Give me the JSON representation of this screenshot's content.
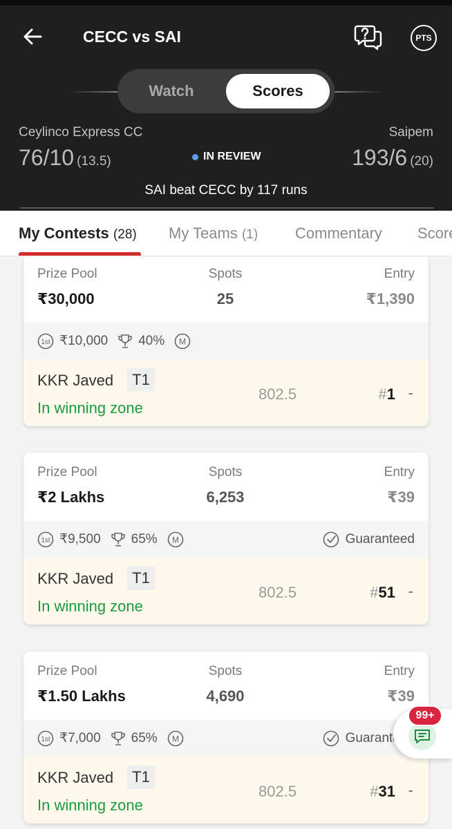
{
  "header": {
    "title": "CECC vs SAI",
    "pts_label": "PTS",
    "segment": {
      "watch": "Watch",
      "scores": "Scores"
    },
    "team_left": {
      "name": "Ceylinco Express CC",
      "score": "76/10",
      "overs": "(13.5)"
    },
    "team_right": {
      "name": "Saipem",
      "score": "193/6",
      "overs": "(20)"
    },
    "status": "IN REVIEW",
    "result": "SAI beat CECC by 117 runs",
    "colors": {
      "background": "#1f1f1f",
      "status_dot": "#5b9de8"
    }
  },
  "tabs": [
    {
      "label": "My Contests",
      "count": "(28)",
      "active": true
    },
    {
      "label": "My Teams",
      "count": "(1)",
      "active": false
    },
    {
      "label": "Commentary",
      "count": "",
      "active": false
    },
    {
      "label": "Scorecard",
      "count": "",
      "active": false
    }
  ],
  "labels": {
    "prize_pool": "Prize Pool",
    "spots": "Spots",
    "entry": "Entry",
    "guaranteed": "Guaranteed"
  },
  "contests": [
    {
      "prize_pool": "₹30,000",
      "spots": "25",
      "entry": "₹1,390",
      "first_prize": "₹10,000",
      "winners_pct": "40%",
      "multi_entry": "M",
      "guaranteed": false,
      "team": {
        "name": "KKR Javed",
        "tag": "T1",
        "status": "In winning zone",
        "points": "802.5",
        "rank_prefix": "#",
        "rank": "1",
        "change": "-"
      }
    },
    {
      "prize_pool": "₹2 Lakhs",
      "spots": "6,253",
      "entry": "₹39",
      "first_prize": "₹9,500",
      "winners_pct": "65%",
      "multi_entry": "M",
      "guaranteed": true,
      "team": {
        "name": "KKR Javed",
        "tag": "T1",
        "status": "In winning zone",
        "points": "802.5",
        "rank_prefix": "#",
        "rank": "51",
        "change": "-"
      }
    },
    {
      "prize_pool": "₹1.50 Lakhs",
      "spots": "4,690",
      "entry": "₹39",
      "first_prize": "₹7,000",
      "winners_pct": "65%",
      "multi_entry": "M",
      "guaranteed": true,
      "team": {
        "name": "KKR Javed",
        "tag": "T1",
        "status": "In winning zone",
        "points": "802.5",
        "rank_prefix": "#",
        "rank": "31",
        "change": "-"
      }
    }
  ],
  "chat": {
    "badge": "99+"
  },
  "icons": [
    "back-arrow-icon",
    "help-chat-icon",
    "first-prize-icon",
    "trophy-icon",
    "multi-entry-icon",
    "guaranteed-check-icon",
    "chat-icon"
  ],
  "theme": {
    "accent": "#d32a2a",
    "winning": "#1c9a3e",
    "team_row_bg": "#fdf9ec",
    "badge": "#d7263d"
  }
}
